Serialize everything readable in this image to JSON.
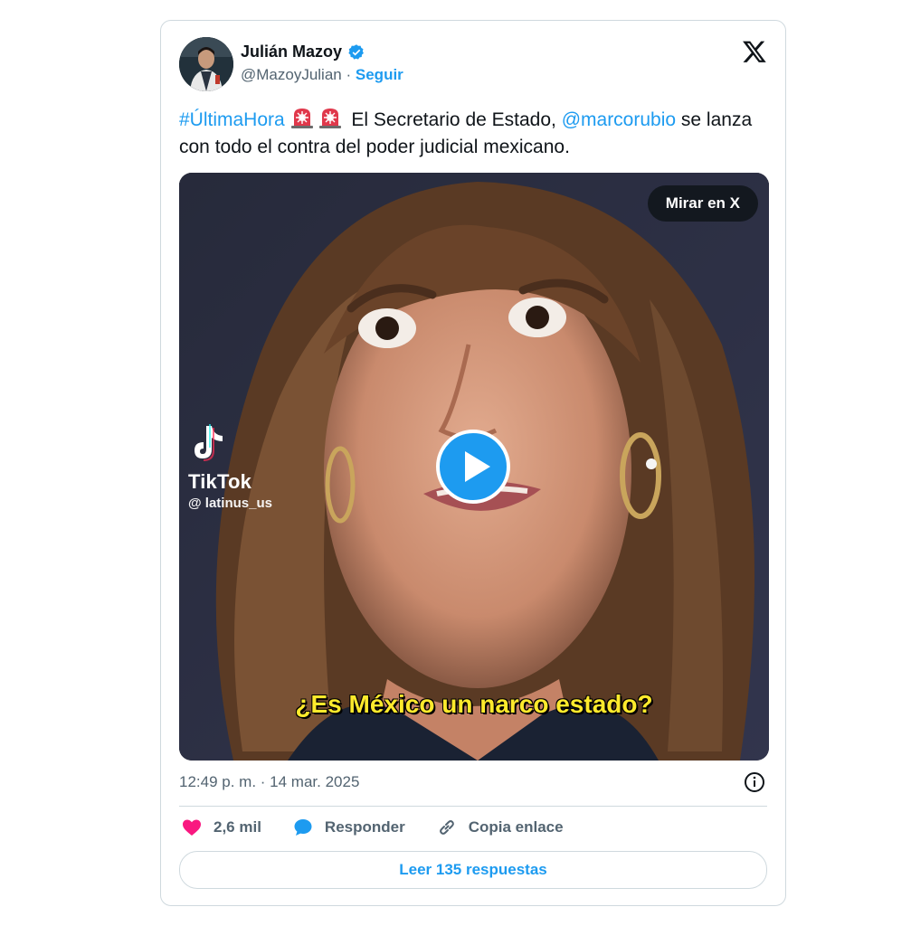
{
  "author": {
    "name": "Julián Mazoy",
    "handle": "@MazoyJulian",
    "separator": "·",
    "follow_label": "Seguir"
  },
  "tweet": {
    "hashtag": "#ÚltimaHora",
    "text_part1": "El Secretario de Estado,",
    "mention": "@marcorubio",
    "text_part2": "se lanza con todo el contra del poder judicial mexicano."
  },
  "media": {
    "watch_label": "Mirar en X",
    "watermark_brand": "TikTok",
    "watermark_handle": "@ latinus_us",
    "caption": "¿Es México un narco estado?"
  },
  "meta": {
    "timestamp": "12:49 p. m. · 14 mar. 2025"
  },
  "actions": {
    "likes": "2,6 mil",
    "reply_label": "Responder",
    "copy_label": "Copia enlace",
    "read_replies": "Leer 135 respuestas"
  },
  "colors": {
    "accent": "#1d9bf0",
    "like": "#f91880",
    "caption": "#ffea2c"
  },
  "icons": [
    "x-logo-icon",
    "verified-badge-icon",
    "siren-icon",
    "play-icon",
    "tiktok-icon",
    "info-icon",
    "heart-icon",
    "reply-bubble-icon",
    "link-icon"
  ]
}
